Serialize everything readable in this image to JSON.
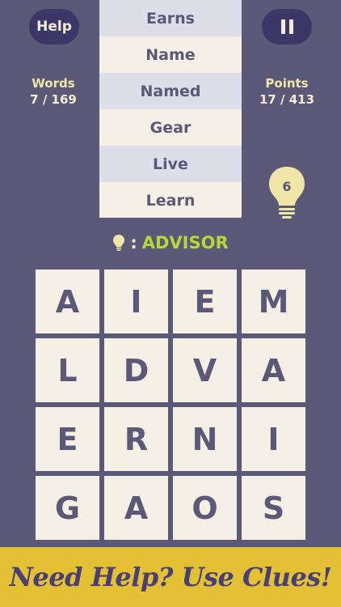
{
  "header": {
    "help_label": "Help",
    "pause_icon": "pause-icon",
    "words_label": "Words",
    "words_value": "7 / 169",
    "points_label": "Points",
    "points_value": "17 / 413"
  },
  "found_words": [
    "Earns",
    "Name",
    "Named",
    "Gear",
    "Live",
    "Learn"
  ],
  "hints": {
    "count": "6",
    "icon": "lightbulb-icon"
  },
  "clue": {
    "icon": "lightbulb-icon",
    "separator": ":",
    "word": "ADVISOR"
  },
  "grid": {
    "rows": [
      [
        "A",
        "I",
        "E",
        "M"
      ],
      [
        "L",
        "D",
        "V",
        "A"
      ],
      [
        "E",
        "R",
        "N",
        "I"
      ],
      [
        "G",
        "A",
        "O",
        "S"
      ]
    ]
  },
  "banner": {
    "text": "Need Help? Use Clues!"
  },
  "colors": {
    "background": "#5b5878",
    "button": "#3c3766",
    "tile": "#f4f0e6",
    "row_alt": "#deddea",
    "accent_green": "#b5d83a",
    "hint_yellow": "#f0e6a8",
    "banner": "#e4c035",
    "banner_text": "#4a3f74"
  }
}
